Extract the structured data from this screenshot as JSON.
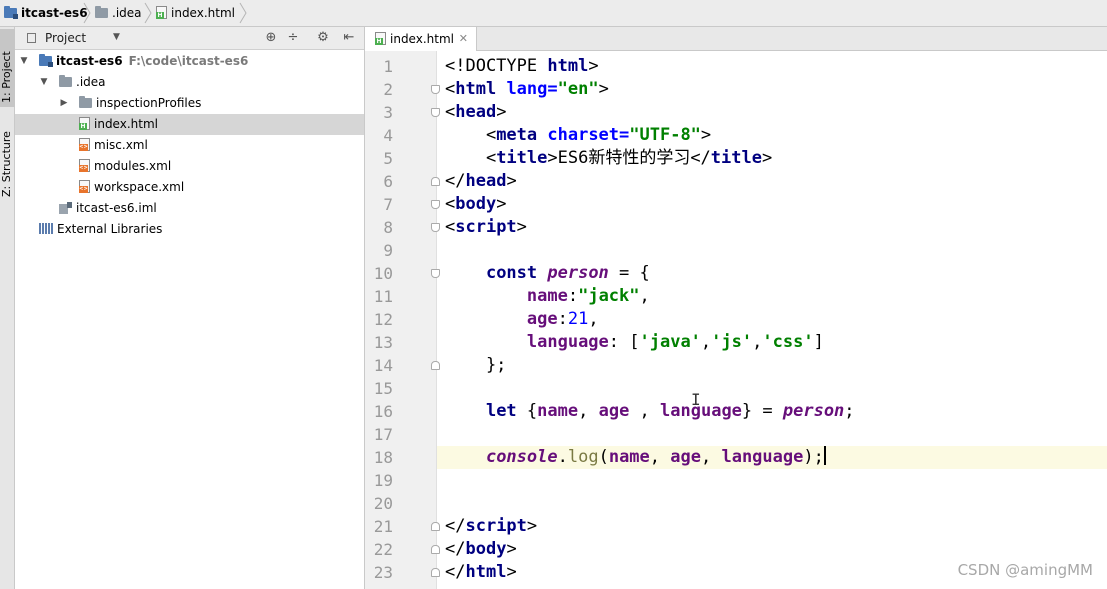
{
  "breadcrumb": {
    "project": "itcast-es6",
    "folder": ".idea",
    "file": "index.html"
  },
  "toolstrip": {
    "project_tab": "1: Project",
    "structure_tab": "Z: Structure"
  },
  "project_panel": {
    "title": "Project",
    "tree": [
      {
        "label": "itcast-es6",
        "path": "F:\\code\\itcast-es6",
        "icon": "folder-module-icon",
        "level": 0,
        "expanded": true,
        "bold": true
      },
      {
        "label": ".idea",
        "icon": "folder-icon",
        "level": 1,
        "expanded": true
      },
      {
        "label": "inspectionProfiles",
        "icon": "folder-icon",
        "level": 2,
        "expanded": false
      },
      {
        "label": "index.html",
        "icon": "html-file-icon",
        "level": 2,
        "selected": true
      },
      {
        "label": "misc.xml",
        "icon": "xml-file-icon",
        "level": 2
      },
      {
        "label": "modules.xml",
        "icon": "xml-file-icon",
        "level": 2
      },
      {
        "label": "workspace.xml",
        "icon": "xml-file-icon",
        "level": 2
      },
      {
        "label": "itcast-es6.iml",
        "icon": "iml-file-icon",
        "level": 1
      },
      {
        "label": "External Libraries",
        "icon": "library-icon",
        "level": 0
      }
    ]
  },
  "editor": {
    "tab_label": "index.html",
    "current_line": 18,
    "lines": [
      [
        [
          "<!DOCTYPE ",
          "plain"
        ],
        [
          "html",
          "tag"
        ],
        [
          ">",
          "plain"
        ]
      ],
      [
        [
          "<",
          "plain"
        ],
        [
          "html ",
          "tag"
        ],
        [
          "lang=",
          "attr"
        ],
        [
          "\"en\"",
          "str"
        ],
        [
          ">",
          "plain"
        ]
      ],
      [
        [
          "<",
          "plain"
        ],
        [
          "head",
          "tag"
        ],
        [
          ">",
          "plain"
        ]
      ],
      [
        [
          "    <",
          "plain"
        ],
        [
          "meta ",
          "tag"
        ],
        [
          "charset=",
          "attr"
        ],
        [
          "\"UTF-8\"",
          "str"
        ],
        [
          ">",
          "plain"
        ]
      ],
      [
        [
          "    <",
          "plain"
        ],
        [
          "title",
          "tag"
        ],
        [
          ">ES6新特性的学习</",
          "plain"
        ],
        [
          "title",
          "tag"
        ],
        [
          ">",
          "plain"
        ]
      ],
      [
        [
          "</",
          "plain"
        ],
        [
          "head",
          "tag"
        ],
        [
          ">",
          "plain"
        ]
      ],
      [
        [
          "<",
          "plain"
        ],
        [
          "body",
          "tag"
        ],
        [
          ">",
          "plain"
        ]
      ],
      [
        [
          "<",
          "plain"
        ],
        [
          "script",
          "tag"
        ],
        [
          ">",
          "plain"
        ]
      ],
      [],
      [
        [
          "    ",
          "plain"
        ],
        [
          "const ",
          "kw"
        ],
        [
          "person",
          "var"
        ],
        [
          " = {",
          "plain"
        ]
      ],
      [
        [
          "        ",
          "plain"
        ],
        [
          "name",
          "prop"
        ],
        [
          ":",
          "plain"
        ],
        [
          "\"jack\"",
          "str"
        ],
        [
          ",",
          "plain"
        ]
      ],
      [
        [
          "        ",
          "plain"
        ],
        [
          "age",
          "prop"
        ],
        [
          ":",
          "plain"
        ],
        [
          "21",
          "num"
        ],
        [
          ",",
          "plain"
        ]
      ],
      [
        [
          "        ",
          "plain"
        ],
        [
          "language",
          "prop"
        ],
        [
          ": [",
          "plain"
        ],
        [
          "'java'",
          "str"
        ],
        [
          ",",
          "plain"
        ],
        [
          "'js'",
          "str"
        ],
        [
          ",",
          "plain"
        ],
        [
          "'css'",
          "str"
        ],
        [
          "]",
          "plain"
        ]
      ],
      [
        [
          "    };",
          "plain"
        ]
      ],
      [],
      [
        [
          "    ",
          "plain"
        ],
        [
          "let ",
          "kw"
        ],
        [
          "{",
          "plain"
        ],
        [
          "name",
          "prop"
        ],
        [
          ", ",
          "plain"
        ],
        [
          "age",
          "prop"
        ],
        [
          " , ",
          "plain"
        ],
        [
          "language",
          "prop"
        ],
        [
          "} = ",
          "plain"
        ],
        [
          "person",
          "var"
        ],
        [
          ";",
          "plain"
        ]
      ],
      [],
      [
        [
          "    ",
          "plain"
        ],
        [
          "console",
          "var"
        ],
        [
          ".",
          "plain"
        ],
        [
          "log",
          "fn"
        ],
        [
          "(",
          "plain"
        ],
        [
          "name",
          "prop"
        ],
        [
          ", ",
          "plain"
        ],
        [
          "age",
          "prop"
        ],
        [
          ", ",
          "plain"
        ],
        [
          "language",
          "prop"
        ],
        [
          ");",
          "plain"
        ]
      ],
      [],
      [],
      [
        [
          "</",
          "plain"
        ],
        [
          "script",
          "tag"
        ],
        [
          ">",
          "plain"
        ]
      ],
      [
        [
          "</",
          "plain"
        ],
        [
          "body",
          "tag"
        ],
        [
          ">",
          "plain"
        ]
      ],
      [
        [
          "</",
          "plain"
        ],
        [
          "html",
          "tag"
        ],
        [
          ">",
          "plain"
        ]
      ]
    ]
  },
  "watermark": "CSDN @amingMM"
}
